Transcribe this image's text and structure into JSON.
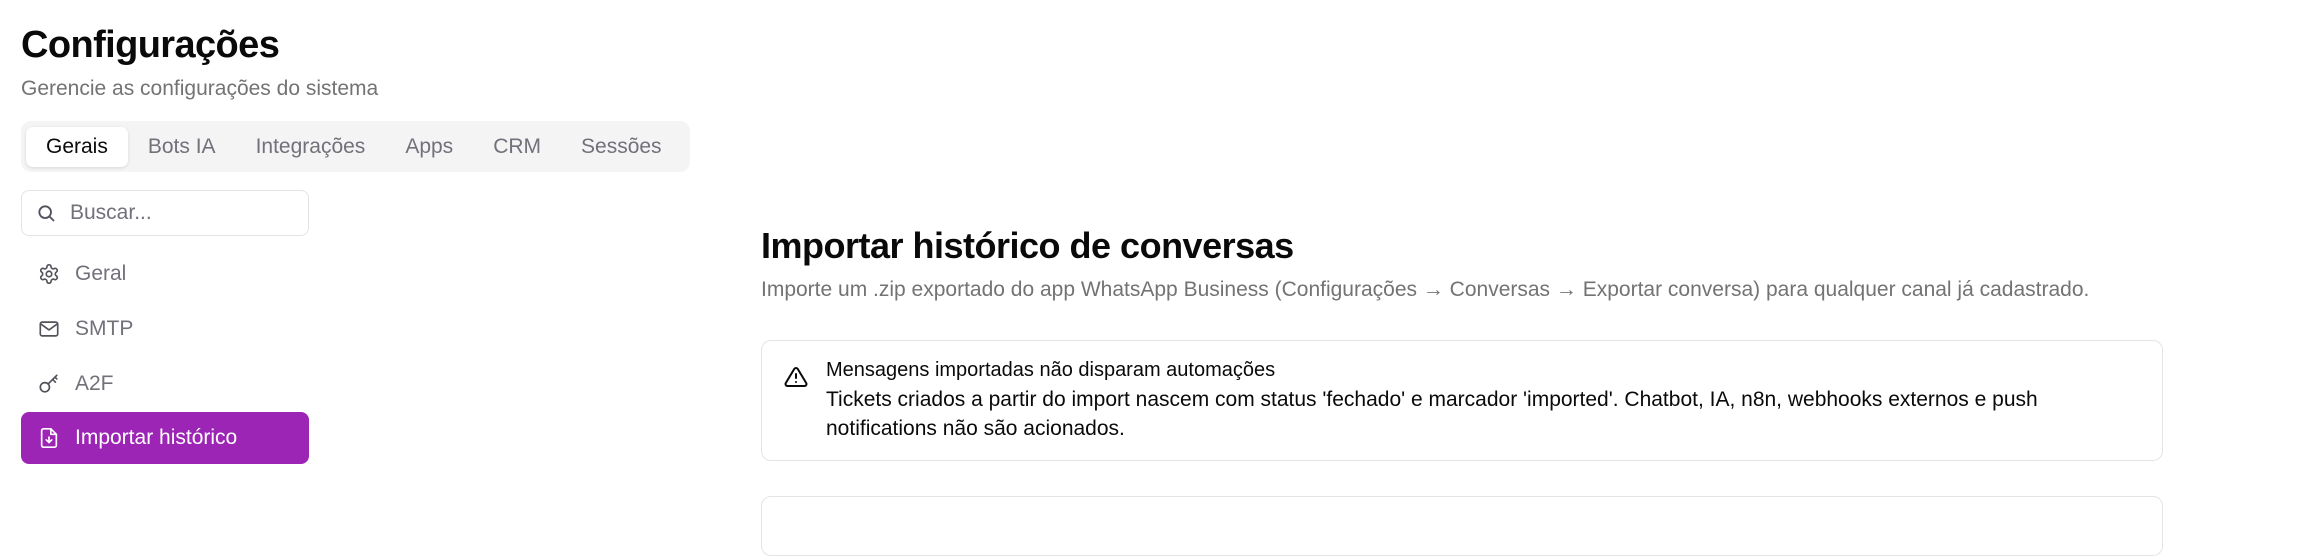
{
  "header": {
    "title": "Configurações",
    "subtitle": "Gerencie as configurações do sistema"
  },
  "tabs": [
    {
      "label": "Gerais",
      "active": true
    },
    {
      "label": "Bots IA"
    },
    {
      "label": "Integrações"
    },
    {
      "label": "Apps"
    },
    {
      "label": "CRM"
    },
    {
      "label": "Sessões"
    }
  ],
  "search": {
    "placeholder": "Buscar...",
    "icon": "search-icon"
  },
  "sidebar": {
    "items": [
      {
        "label": "Geral",
        "icon": "gear-icon"
      },
      {
        "label": "SMTP",
        "icon": "mail-icon"
      },
      {
        "label": "A2F",
        "icon": "key-icon"
      },
      {
        "label": "Importar histórico",
        "icon": "file-import-icon",
        "active": true
      }
    ]
  },
  "main": {
    "title": "Importar histórico de conversas",
    "description": "Importe um .zip exportado do app WhatsApp Business (Configurações → Conversas → Exportar conversa) para qualquer canal já cadastrado.",
    "alert": {
      "icon": "warning-icon",
      "title": "Mensagens importadas não disparam automações",
      "body": "Tickets criados a partir do import nascem com status 'fechado' e marcador 'imported'. Chatbot, IA, n8n, webhooks externos e push notifications não são acionados."
    }
  },
  "colors": {
    "accent": "#9d25b5",
    "muted_text": "#737373",
    "border": "#e4e4e7",
    "tabs_bg": "#f4f4f5"
  }
}
